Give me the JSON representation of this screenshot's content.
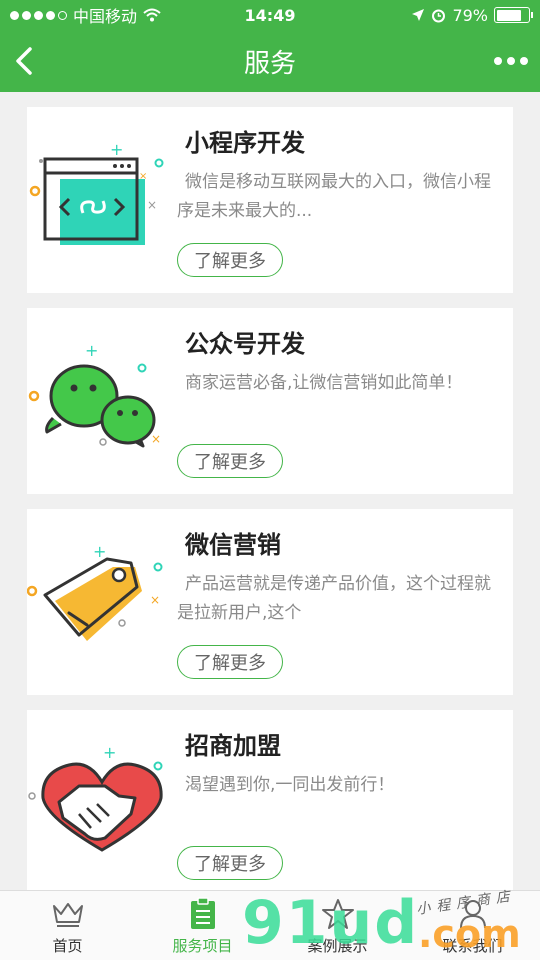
{
  "status": {
    "carrier": "中国移动",
    "time": "14:49",
    "battery": "79%",
    "battery_level": 0.79
  },
  "nav": {
    "title": "服务"
  },
  "cards": [
    {
      "title": "小程序开发",
      "desc": "微信是移动互联网最大的入口，微信小程序是未来最大的...",
      "button": "了解更多",
      "icon": "miniprogram-icon"
    },
    {
      "title": "公众号开发",
      "desc": "商家运营必备,让微信营销如此简单！",
      "button": "了解更多",
      "icon": "wechat-icon"
    },
    {
      "title": "微信营销",
      "desc": "产品运营就是传递产品价值，这个过程就是拉新用户,这个",
      "button": "了解更多",
      "icon": "tag-icon"
    },
    {
      "title": "招商加盟",
      "desc": "渴望遇到你,一同出发前行！",
      "button": "了解更多",
      "icon": "handshake-icon"
    }
  ],
  "tabs": [
    {
      "label": "首页",
      "icon": "crown-icon"
    },
    {
      "label": "服务项目",
      "icon": "clipboard-icon"
    },
    {
      "label": "案例展示",
      "icon": "star-icon"
    },
    {
      "label": "联系我们",
      "icon": "contact-icon"
    }
  ],
  "watermark": {
    "main": "91ud",
    "domain": ".com",
    "tagline": "小程序商店"
  },
  "colors": {
    "brand_green": "#44b549",
    "teal": "#2fd4b7",
    "orange": "#f4a623",
    "red": "#e84a4a"
  }
}
